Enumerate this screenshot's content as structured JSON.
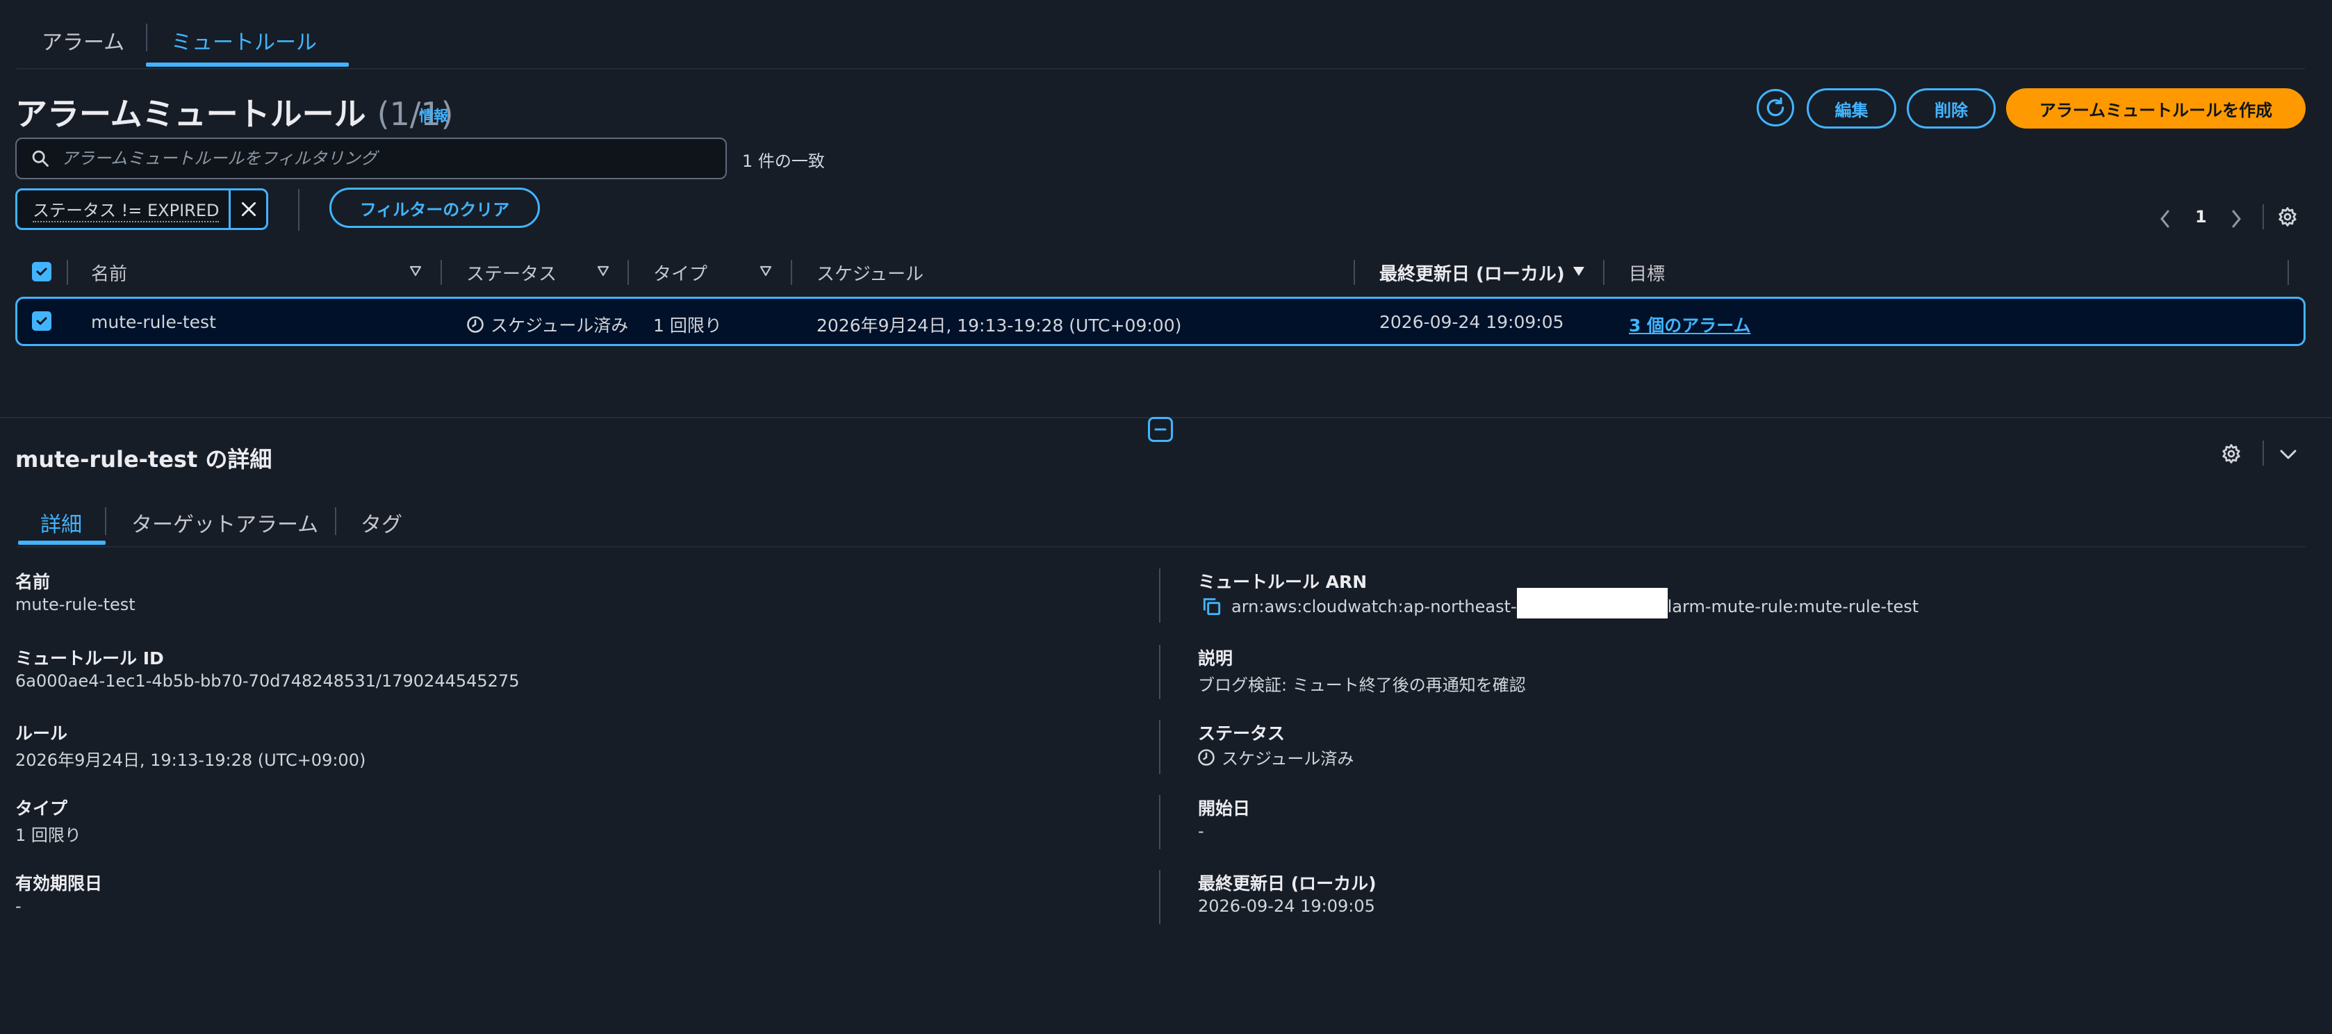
{
  "top_tabs": {
    "alarms": "アラーム",
    "mute_rules": "ミュートルール"
  },
  "header": {
    "title": "アラームミュートルール",
    "count": "(1/1)",
    "info": "情報",
    "edit": "編集",
    "delete": "削除",
    "create": "アラームミュートルールを作成"
  },
  "search": {
    "placeholder": "アラームミュートルールをフィルタリング",
    "match_count": "1 件の一致"
  },
  "filter": {
    "token": "ステータス != EXPIRED",
    "clear": "フィルターのクリア"
  },
  "pagination": {
    "page": "1"
  },
  "table": {
    "columns": {
      "name": "名前",
      "status": "ステータス",
      "type": "タイプ",
      "schedule": "スケジュール",
      "last_updated": "最終更新日 (ローカル)",
      "target": "目標"
    },
    "rows": [
      {
        "name": "mute-rule-test",
        "status": "スケジュール済み",
        "type": "1 回限り",
        "schedule": "2026年9月24日, 19:13-19:28 (UTC+09:00)",
        "last_updated": "2026-09-24 19:09:05",
        "target": "3 個のアラーム"
      }
    ]
  },
  "details": {
    "title": "mute-rule-test の詳細",
    "tabs": {
      "details": "詳細",
      "target_alarms": "ターゲットアラーム",
      "tags": "タグ"
    },
    "left": {
      "name_label": "名前",
      "name_value": "mute-rule-test",
      "id_label": "ミュートルール ID",
      "id_value": "6a000ae4-1ec1-4b5b-bb70-70d748248531/1790244545275",
      "rule_label": "ルール",
      "rule_value": "2026年9月24日, 19:13-19:28 (UTC+09:00)",
      "type_label": "タイプ",
      "type_value": "1 回限り",
      "expiry_label": "有効期限日",
      "expiry_value": "-"
    },
    "right": {
      "arn_label": "ミュートルール ARN",
      "arn_prefix": "arn:aws:cloudwatch:ap-northeast-",
      "arn_suffix": "larm-mute-rule:mute-rule-test",
      "desc_label": "説明",
      "desc_value": "ブログ検証: ミュート終了後の再通知を確認",
      "status_label": "ステータス",
      "status_value": "スケジュール済み",
      "start_label": "開始日",
      "start_value": "-",
      "updated_label": "最終更新日 (ローカル)",
      "updated_value": "2026-09-24 19:09:05"
    }
  },
  "colors": {
    "accent": "#42b4ff",
    "primary_button": "#ff9900",
    "background": "#161d26",
    "selected_row": "#001129"
  }
}
